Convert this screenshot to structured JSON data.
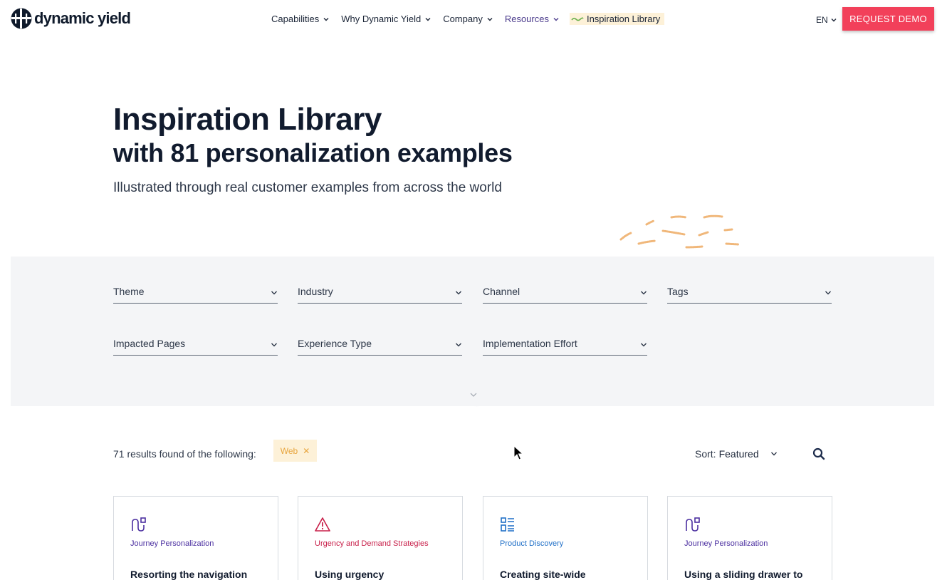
{
  "header": {
    "brand": "dynamic yield",
    "nav": [
      {
        "label": "Capabilities"
      },
      {
        "label": "Why Dynamic Yield"
      },
      {
        "label": "Company"
      },
      {
        "label": "Resources"
      },
      {
        "label": "Inspiration Library"
      }
    ],
    "lang": "EN",
    "demo_label": "REQUEST DEMO"
  },
  "hero": {
    "title": "Inspiration Library",
    "subtitle": "with 81 personalization examples",
    "description": "Illustrated through real customer examples from across the world"
  },
  "filters": [
    {
      "label": "Theme"
    },
    {
      "label": "Industry"
    },
    {
      "label": "Channel"
    },
    {
      "label": "Tags"
    },
    {
      "label": "Impacted Pages"
    },
    {
      "label": "Experience Type"
    },
    {
      "label": "Implementation Effort"
    }
  ],
  "results": {
    "count_text": "71 results found of the following:",
    "chip": "Web",
    "sort_label": "Sort:",
    "sort_value": "Featured"
  },
  "cards": [
    {
      "icon": "journey-icon",
      "category": "Journey Personalization",
      "color": "#4b2fa0",
      "title": "Resorting the navigation"
    },
    {
      "icon": "warning-icon",
      "category": "Urgency and Demand Strategies",
      "color": "#c8204a",
      "title": "Using urgency"
    },
    {
      "icon": "list-icon",
      "category": "Product Discovery",
      "color": "#1f6fc7",
      "title": "Creating site-wide"
    },
    {
      "icon": "journey-icon",
      "category": "Journey Personalization",
      "color": "#4b2fa0",
      "title": "Using a sliding drawer to"
    }
  ],
  "colors": {
    "accent": "#f2405a",
    "nav_active": "#4b3b8c",
    "chip_bg": "#fdf1d8",
    "chip_text": "#e8a53d",
    "filter_bg": "#f4f5f7"
  }
}
